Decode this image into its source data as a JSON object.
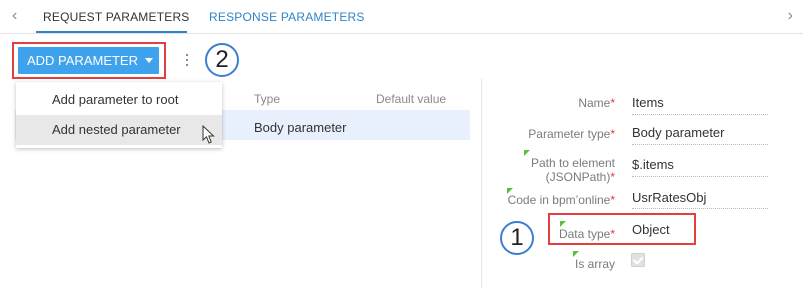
{
  "tabs": {
    "prev_arrow": "‹",
    "next_arrow": "›",
    "request": "REQUEST PARAMETERS",
    "response": "RESPONSE PARAMETERS"
  },
  "toolbar": {
    "add_parameter": "ADD PARAMETER",
    "badge_2": "2"
  },
  "menu": {
    "items": [
      "Add parameter to root",
      "Add nested parameter"
    ]
  },
  "grid": {
    "headers": {
      "type": "Type",
      "default_value": "Default value"
    },
    "selected_row": {
      "type": "Body parameter"
    }
  },
  "properties": {
    "badge_1": "1",
    "name": {
      "label": "Name",
      "value": "Items"
    },
    "parameter_type": {
      "label": "Parameter type",
      "value": "Body parameter"
    },
    "path": {
      "label_line1": "Path to element",
      "label_line2": "(JSONPath)",
      "value": "$.items"
    },
    "code": {
      "label": "Code in bpm’online",
      "value": "UsrRatesObj"
    },
    "data_type": {
      "label": "Data type",
      "value": "Object"
    },
    "is_array": {
      "label": "Is array",
      "checked": true
    },
    "required_mark": "*"
  },
  "colors": {
    "accent": "#3fa2ec",
    "tab_active": "#2f84c8",
    "highlight_red": "#e2403f",
    "badge_blue": "#3b7ed3",
    "required_red": "#e5383b",
    "corner_green": "#5bbf38",
    "selected_row": "#e7f0fc"
  }
}
